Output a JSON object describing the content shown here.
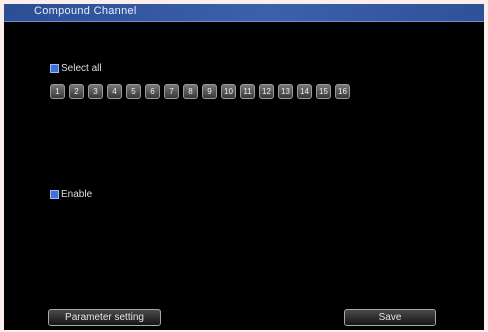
{
  "window": {
    "title": "Compound Channel"
  },
  "select_all": {
    "label": "Select all",
    "checked": true
  },
  "channels": [
    "1",
    "2",
    "3",
    "4",
    "5",
    "6",
    "7",
    "8",
    "9",
    "10",
    "11",
    "12",
    "13",
    "14",
    "15",
    "16"
  ],
  "enable": {
    "label": "Enable",
    "checked": true
  },
  "buttons": {
    "parameter_setting": "Parameter setting",
    "save": "Save"
  },
  "colors": {
    "titlebar": "#3b61ad",
    "background": "#000000",
    "checkbox": "#3f6fd8"
  }
}
